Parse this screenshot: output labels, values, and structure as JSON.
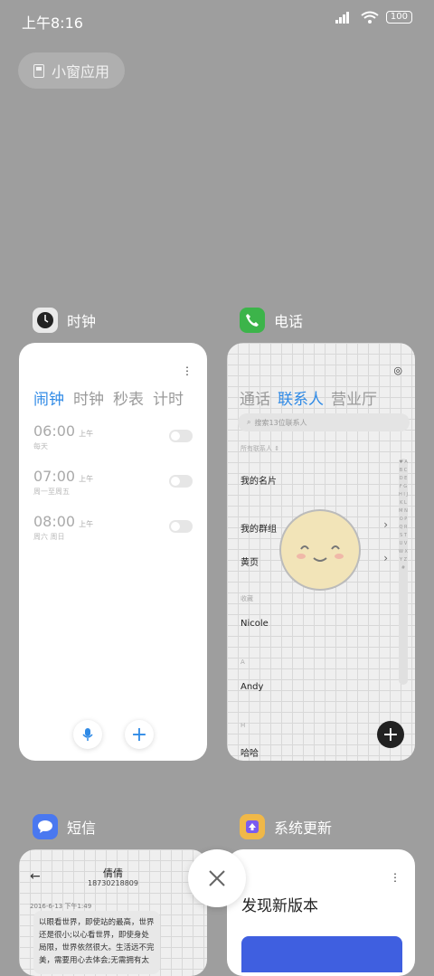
{
  "status": {
    "time": "上午8:16",
    "battery": "100"
  },
  "small_window_label": "小窗应用",
  "apps": {
    "clock": {
      "title": "时钟",
      "tabs": [
        "闹钟",
        "时钟",
        "秒表",
        "计时"
      ],
      "alarms": [
        {
          "time": "06:00",
          "ampm": "上午",
          "repeat": "每天"
        },
        {
          "time": "07:00",
          "ampm": "上午",
          "repeat": "周一至周五"
        },
        {
          "time": "08:00",
          "ampm": "上午",
          "repeat": "周六 周日"
        }
      ]
    },
    "phone": {
      "title": "电话",
      "tabs": [
        "通话",
        "联系人",
        "营业厅"
      ],
      "search_placeholder": "搜索13位联系人",
      "all_contacts": "所有联系人",
      "rows": [
        "我的名片",
        "我的群组",
        "黄页"
      ],
      "sections": [
        "收藏",
        "A",
        "H"
      ],
      "contacts": [
        "Nicole",
        "Andy",
        "哈哈"
      ],
      "az": "♥ A B C D E F G H I J K L M N O P Q R S T U V W X Y Z #"
    },
    "messages": {
      "title": "短信",
      "contact_name": "倩倩",
      "contact_number": "18730218809",
      "date": "2016-6-13 下午1:49",
      "body": "以眼看世界，即使站的最高，世界还是很小;以心看世界，即使身处局限，世界依然很大。生活远不完美，需要用心去体会;无需拥有太"
    },
    "update": {
      "title": "系统更新",
      "headline": "发现新版本"
    }
  },
  "colors": {
    "accent": "#2f8ae6",
    "background": "#9e9e9e"
  }
}
